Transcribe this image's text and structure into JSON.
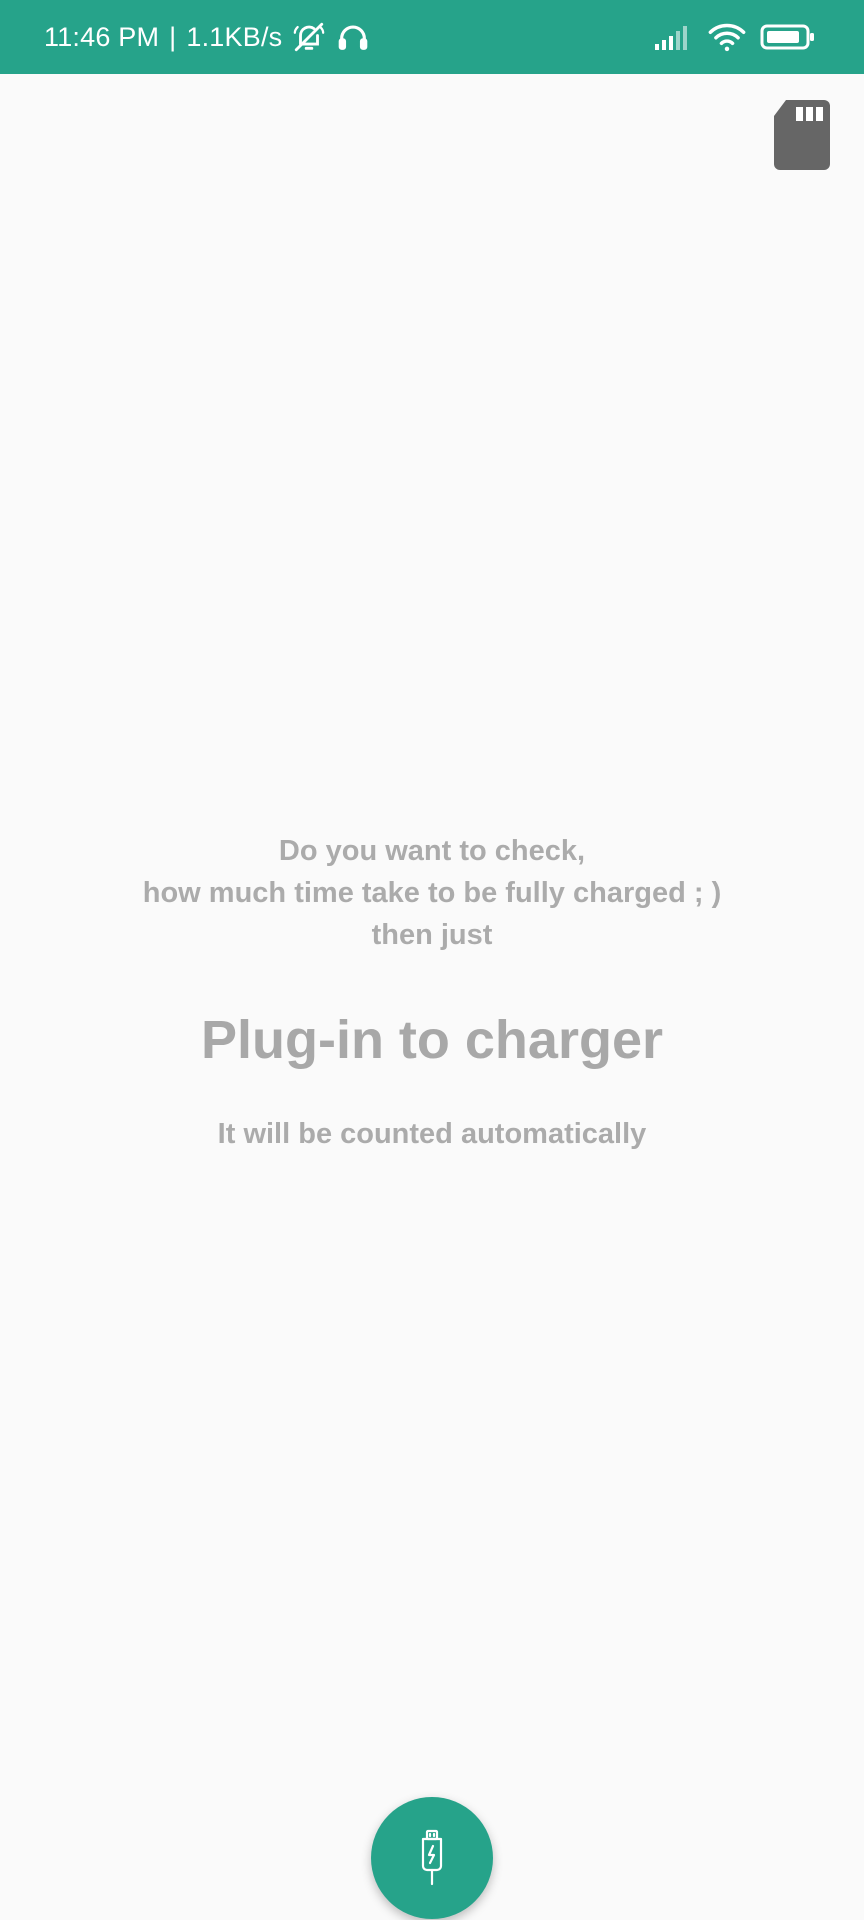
{
  "status_bar": {
    "time": "11:46 PM",
    "separator": "|",
    "network_speed": "1.1KB/s",
    "icons": [
      "notifications-off-icon",
      "headphones-icon",
      "signal-icon",
      "wifi-icon",
      "battery-icon"
    ],
    "background_color": "#26a38a"
  },
  "toolbar": {
    "sd_icon": "sd-card-icon"
  },
  "message": {
    "line1": "Do you want to check,",
    "line2": "how much time take to be fully charged ; )",
    "line3": "then just",
    "headline": "Plug-in to charger",
    "subtext": "It will be counted automatically",
    "text_color": "#ababab"
  },
  "fab": {
    "icon": "usb-charger-icon",
    "color": "#26a38a"
  }
}
